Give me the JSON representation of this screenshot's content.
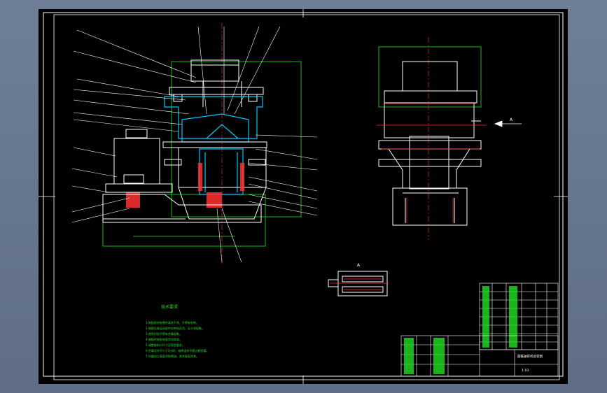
{
  "notes": {
    "heading": "技术要求",
    "lines": [
      "1.装配前所有零件清洗干净，不得有毛刺。",
      "2.装配后各运动部件应转动灵活，无卡滞现象。",
      "3.各密封处不得有渗漏现象。",
      "4.装配时各配合面涂润滑油。",
      "5.调整排料口尺寸至规定要求。",
      "6.空载试车不少于2小时，轴承温升不超过规定值。",
      "7.外露加工表面涂防锈油，其余表面涂漆。"
    ]
  },
  "detail_view": {
    "label": "A"
  },
  "side_view": {
    "label": "A"
  },
  "title_block": {
    "drawing_name": "圆锥破碎机总装图",
    "scale": "1:10"
  },
  "colors": {
    "outline": "#ffffff",
    "section": "#00c8ff",
    "hatch": "#ff3030",
    "dimension": "#22e022",
    "background": "#000000"
  }
}
